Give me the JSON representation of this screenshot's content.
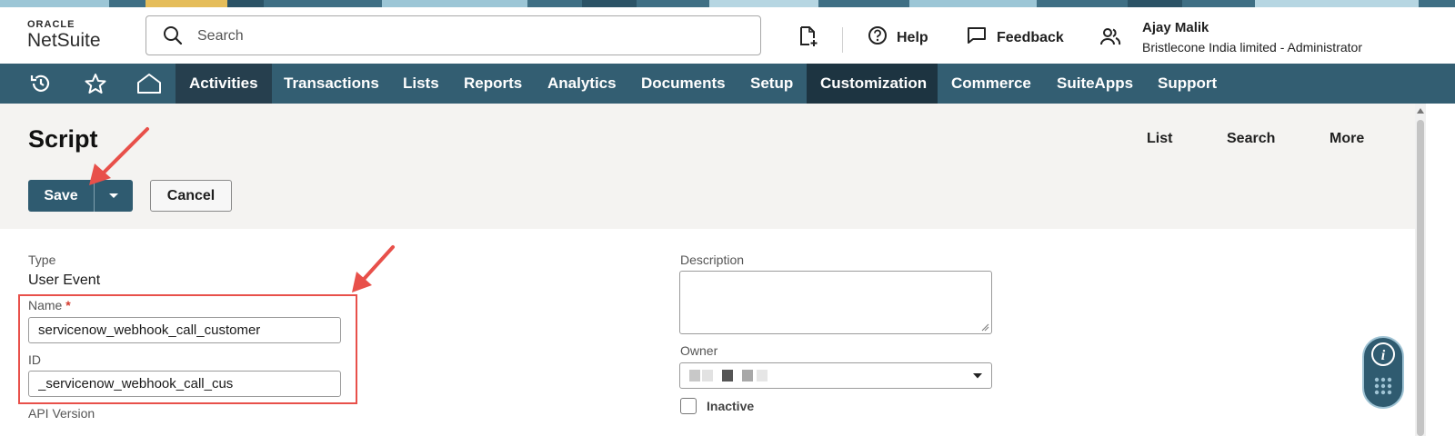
{
  "header": {
    "logo_top": "ORACLE",
    "logo_bottom": "NetSuite",
    "search_placeholder": "Search",
    "help_label": "Help",
    "feedback_label": "Feedback",
    "user_name": "Ajay Malik",
    "user_role": "Bristlecone India limited - Administrator"
  },
  "nav": {
    "items": [
      "Activities",
      "Transactions",
      "Lists",
      "Reports",
      "Analytics",
      "Documents",
      "Setup",
      "Customization",
      "Commerce",
      "SuiteApps",
      "Support"
    ],
    "active": "Customization"
  },
  "page": {
    "title": "Script",
    "links": [
      "List",
      "Search",
      "More"
    ],
    "save_label": "Save",
    "cancel_label": "Cancel"
  },
  "form": {
    "type_label": "Type",
    "type_value": "User Event",
    "name_label": "Name",
    "name_required": "*",
    "name_value": "servicenow_webhook_call_customer",
    "id_label": "ID",
    "id_value": "_servicenow_webhook_call_cus",
    "api_version_label": "API Version",
    "description_label": "Description",
    "owner_label": "Owner",
    "inactive_label": "Inactive"
  },
  "colors": {
    "nav_bg": "#335e72",
    "nav_active": "#1d3441",
    "button_primary": "#2f5b70",
    "annotation": "#e8504a"
  }
}
